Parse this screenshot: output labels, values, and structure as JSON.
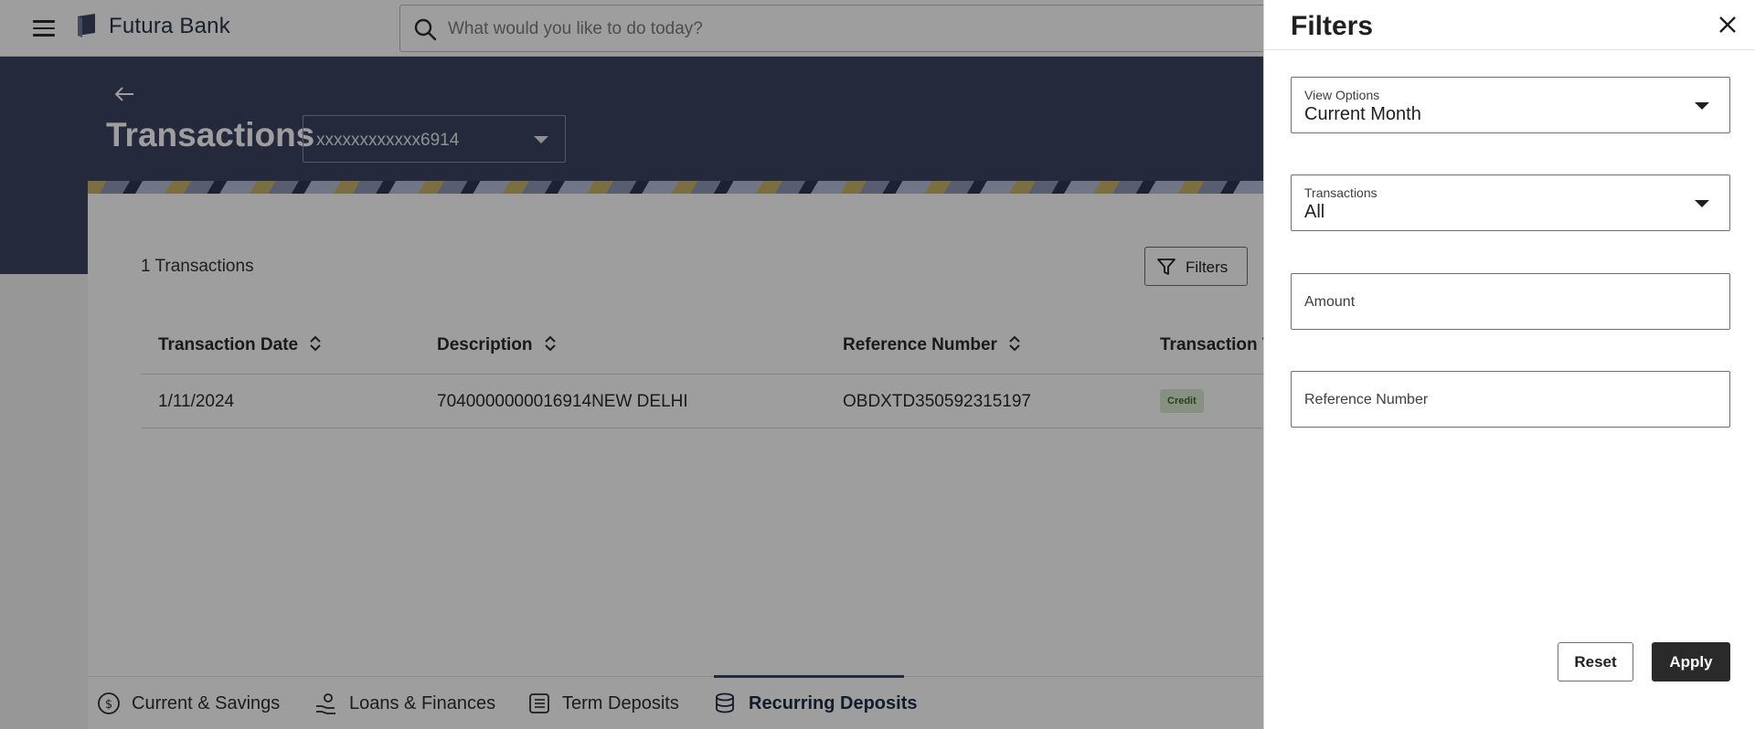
{
  "app": {
    "brand": "Futura Bank"
  },
  "search": {
    "placeholder": "What would you like to do today?"
  },
  "header": {
    "title": "Transactions",
    "account": "xxxxxxxxxxxx6914"
  },
  "summary": {
    "count_label": "1 Transactions",
    "filters_label": "Filters"
  },
  "table": {
    "columns": [
      "Transaction Date",
      "Description",
      "Reference Number",
      "Transaction T"
    ],
    "rows": [
      {
        "date": "1/11/2024",
        "description": "7040000000016914NEW DELHI",
        "reference": "OBDXTD350592315197",
        "type": "Credit"
      }
    ]
  },
  "tabs": [
    {
      "label": "Current & Savings",
      "icon": "dollar-coin-icon"
    },
    {
      "label": "Loans & Finances",
      "icon": "hand-coin-icon"
    },
    {
      "label": "Term Deposits",
      "icon": "ledger-icon"
    },
    {
      "label": "Recurring Deposits",
      "icon": "database-icon",
      "active": true
    }
  ],
  "filters": {
    "title": "Filters",
    "view_options": {
      "label": "View Options",
      "value": "Current Month"
    },
    "transactions": {
      "label": "Transactions",
      "value": "All"
    },
    "amount": {
      "placeholder": "Amount"
    },
    "reference": {
      "placeholder": "Reference Number"
    },
    "reset_label": "Reset",
    "apply_label": "Apply"
  },
  "colors": {
    "hero": "#3a4462",
    "apply": "#2a2a2a",
    "credit_badge": "#d9ead2"
  }
}
